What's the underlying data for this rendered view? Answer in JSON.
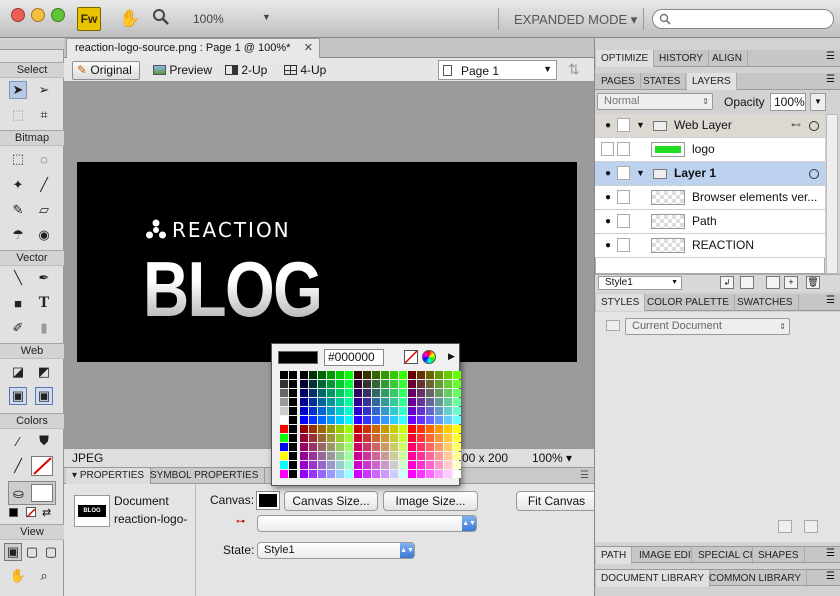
{
  "title_bar": {
    "app_icon": "Fw",
    "hand_icon": "hand-icon",
    "zoom": "100%",
    "mode": "EXPANDED MODE",
    "search_placeholder": ""
  },
  "tools": {
    "sections": [
      "Select",
      "Bitmap",
      "Vector",
      "Web",
      "Colors",
      "View"
    ]
  },
  "document": {
    "tab_title": "reaction-logo-source.png : Page 1 @ 100%*",
    "views": [
      "Original",
      "Preview",
      "2-Up",
      "4-Up"
    ],
    "page": "Page 1",
    "canvas_brand": "REACTION",
    "canvas_headline": "BLOG",
    "status_format": "JPEG",
    "status_size": "00 x 200",
    "status_zoom": "100%"
  },
  "color_popup": {
    "hex": "#000000"
  },
  "properties": {
    "tabs": [
      "PROPERTIES",
      "SYMBOL PROPERTIES"
    ],
    "doc_label": "Document",
    "doc_name": "reaction-logo-",
    "canvas_label": "Canvas:",
    "canvas_size_btn": "Canvas Size...",
    "image_size_btn": "Image Size...",
    "fit_canvas_btn": "Fit Canvas",
    "state_label": "State:",
    "state_value": "Style1",
    "thumb_text": "BLOG"
  },
  "right_panel": {
    "top_tabs": [
      "OPTIMIZE",
      "HISTORY",
      "ALIGN"
    ],
    "layer_tabs": [
      "PAGES",
      "STATES",
      "LAYERS"
    ],
    "blend_mode": "Normal",
    "opacity_label": "Opacity",
    "opacity_value": "100%",
    "layers": [
      {
        "name": "Web Layer",
        "type": "folder"
      },
      {
        "name": "logo",
        "type": "item"
      },
      {
        "name": "Layer 1",
        "type": "folder"
      },
      {
        "name": "Browser elements ver...",
        "type": "item"
      },
      {
        "name": "Path",
        "type": "item"
      },
      {
        "name": "REACTION",
        "type": "item"
      }
    ],
    "state_select": "Style1",
    "style_tabs": [
      "STYLES",
      "COLOR PALETTE",
      "SWATCHES"
    ],
    "style_source": "Current Document",
    "bottom_tabs": [
      "PATH",
      "IMAGE EDIT",
      "SPECIAL CH",
      "SHAPES"
    ],
    "library_tabs": [
      "DOCUMENT LIBRARY",
      "COMMON LIBRARY"
    ]
  }
}
